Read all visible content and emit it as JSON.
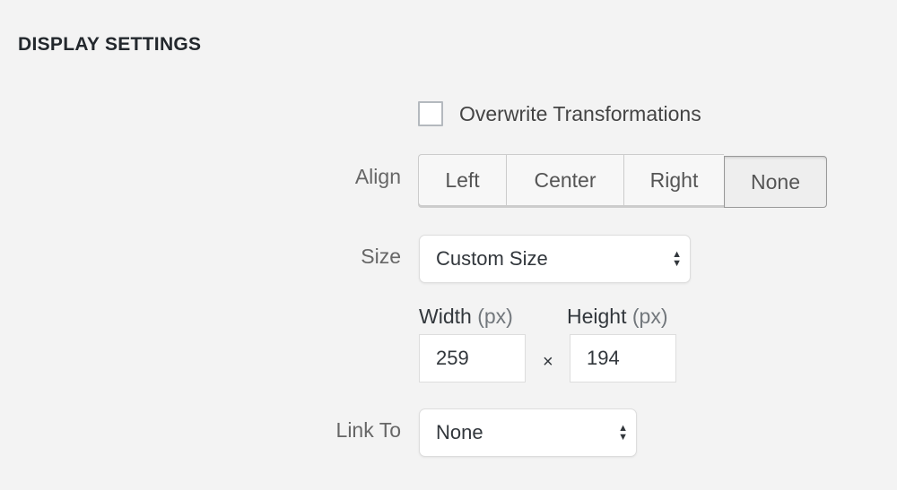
{
  "section": {
    "title": "DISPLAY SETTINGS"
  },
  "overwrite": {
    "label": "Overwrite Transformations",
    "checked": false
  },
  "align": {
    "label": "Align",
    "options": [
      "Left",
      "Center",
      "Right",
      "None"
    ],
    "selected": "None"
  },
  "size": {
    "label": "Size",
    "value": "Custom Size",
    "arrow_icon": "up-down-arrows-icon"
  },
  "dimensions": {
    "width_label": "Width",
    "height_label": "Height",
    "unit": "(px)",
    "width_value": "259",
    "height_value": "194",
    "separator": "×"
  },
  "link_to": {
    "label": "Link To",
    "value": "None",
    "arrow_icon": "up-down-arrows-icon"
  }
}
